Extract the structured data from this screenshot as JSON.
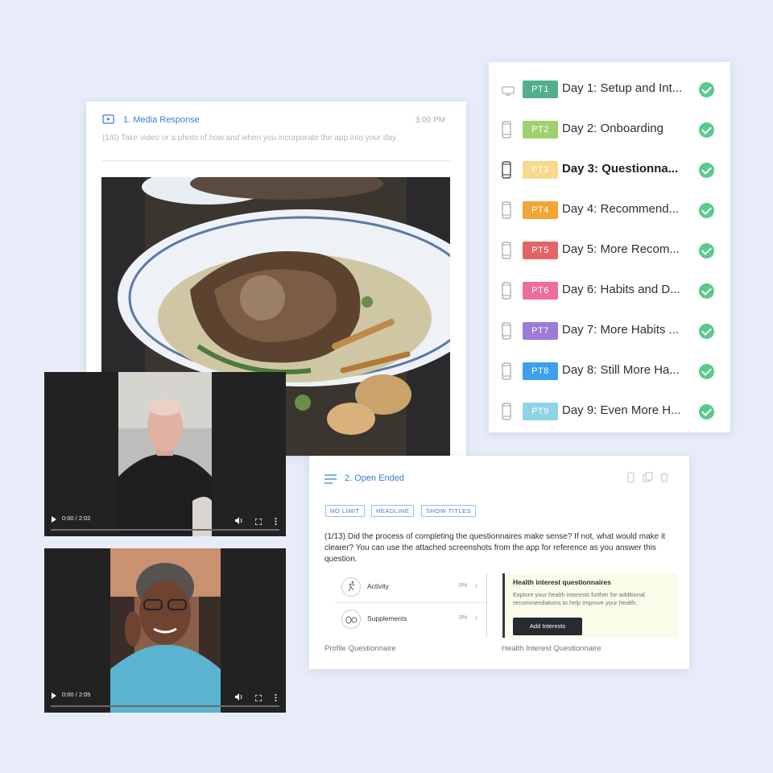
{
  "media_card": {
    "title": "1. Media Response",
    "time": "3:09 PM",
    "prompt": "(1/6) Take video or a photo of how and when you incorporate the app into your day."
  },
  "videos": [
    {
      "time": "0:00 / 2:02"
    },
    {
      "time": "0:00 / 2:05"
    }
  ],
  "tasks": [
    {
      "badge": "PT1",
      "color": "#52b08a",
      "label": "Day 1: Setup and Int...",
      "device": "desktop",
      "bold": false
    },
    {
      "badge": "PT2",
      "color": "#9fd06e",
      "label": "Day 2: Onboarding",
      "device": "phone",
      "bold": false
    },
    {
      "badge": "PT3",
      "color": "#f7d98b",
      "label": "Day 3: Questionna...",
      "device": "phone",
      "bold": true
    },
    {
      "badge": "PT4",
      "color": "#f2a633",
      "label": "Day 4: Recommend...",
      "device": "phone",
      "bold": false
    },
    {
      "badge": "PT5",
      "color": "#e46466",
      "label": "Day 5: More Recom...",
      "device": "phone",
      "bold": false
    },
    {
      "badge": "PT6",
      "color": "#ee6d9e",
      "label": "Day 6: Habits and D...",
      "device": "phone",
      "bold": false
    },
    {
      "badge": "PT7",
      "color": "#9c7bdb",
      "label": "Day 7: More Habits ...",
      "device": "phone",
      "bold": false
    },
    {
      "badge": "PT8",
      "color": "#3ea0ec",
      "label": "Day 8: Still More Ha...",
      "device": "phone",
      "bold": false
    },
    {
      "badge": "PT9",
      "color": "#8fd4e6",
      "label": "Day 9: Even More H...",
      "device": "phone",
      "bold": false
    }
  ],
  "open_card": {
    "title": "2. Open Ended",
    "chips": [
      "NO LIMIT",
      "HEADLINE",
      "SHOW TITLES"
    ],
    "question": "(1/13) Did the process of completing the questionnaires make sense? If not, what would make it clearer? You can use the attached screenshots from the app for reference as you answer this question.",
    "profile_items": [
      {
        "name": "Activity",
        "pct": "0%"
      },
      {
        "name": "Supplements",
        "pct": "0%"
      }
    ],
    "health": {
      "heading": "Health interest questionnaires",
      "desc": "Explore your health interests further for additional recommendations to help improve your health.",
      "button": "Add Interests"
    },
    "caption_left": "Profile Questionnaire",
    "caption_right": "Health Interest Questionnaire"
  },
  "colors": {
    "accent": "#3a7bd5",
    "check": "#5cc98c",
    "background": "#e7ecf8"
  },
  "icons": {
    "media": "play-square-icon",
    "open": "lines-icon",
    "device_desktop": "monitor-icon",
    "device_phone": "phone-icon",
    "check": "check-circle-icon"
  }
}
